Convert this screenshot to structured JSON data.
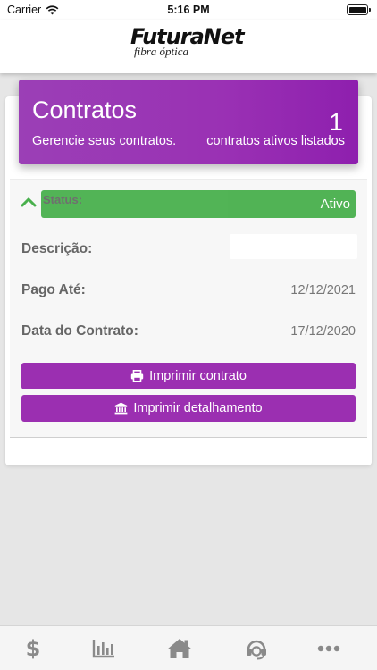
{
  "status_bar": {
    "carrier": "Carrier",
    "time": "5:16 PM",
    "wifi_icon": "wifi-icon",
    "battery_icon": "battery-icon"
  },
  "header": {
    "logo_text": "FuturaNet",
    "logo_subtext": "fibra óptica"
  },
  "contracts": {
    "title": "Contratos",
    "subtitle": "Gerencie seus contratos.",
    "active_count": "1",
    "active_label": "contratos ativos listados",
    "gradient_colors": [
      "#9b3fb6",
      "#8e1fae"
    ]
  },
  "contract_item": {
    "expand_icon": "chevron-up-icon",
    "status_label": "Status:",
    "status_value": "Ativo",
    "status_color": "#49b04d",
    "description_label": "Descrição:",
    "description_value": "",
    "paid_until_label": "Pago Até:",
    "paid_until_value": "12/12/2021",
    "contract_date_label": "Data do Contrato:",
    "contract_date_value": "17/12/2020",
    "print_contract_label": "Imprimir contrato",
    "print_contract_icon": "printer-icon",
    "print_details_label": "Imprimir detalhamento",
    "print_details_icon": "bank-icon",
    "button_color": "#9b2fb1"
  },
  "tab_bar": {
    "items": [
      {
        "name": "financial",
        "icon": "dollar-icon",
        "glyph": "$"
      },
      {
        "name": "usage",
        "icon": "bar-chart-icon"
      },
      {
        "name": "home",
        "icon": "home-icon"
      },
      {
        "name": "support",
        "icon": "headset-icon"
      },
      {
        "name": "more",
        "icon": "more-icon"
      }
    ],
    "icon_color": "#8a8a8a"
  }
}
